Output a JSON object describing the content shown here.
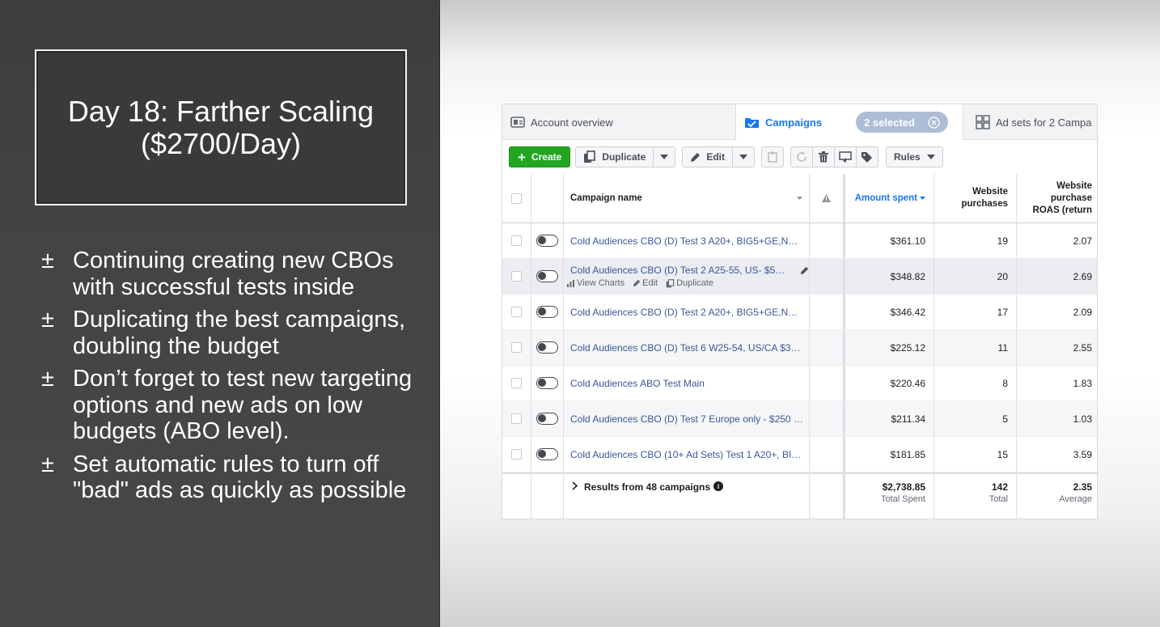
{
  "slide": {
    "title": "Day 18: Farther Scaling\n($2700/Day)",
    "bullet_mark": "±",
    "bullets": [
      "Continuing creating new CBOs with successful tests inside",
      "Duplicating the best campaigns, doubling the budget",
      "Don’t forget to test new targeting options and new ads on low budgets (ABO level).",
      "Set automatic rules to turn off \"bad\" ads as quickly as possible"
    ]
  },
  "ads_manager": {
    "tabs": {
      "account": "Account overview",
      "campaigns": "Campaigns",
      "selected": "2 selected",
      "adsets": "Ad sets for 2 Campa"
    },
    "toolbar": {
      "create": "Create",
      "duplicate": "Duplicate",
      "edit": "Edit",
      "rules": "Rules"
    },
    "columns": {
      "name": "Campaign name",
      "amount": "Amount spent",
      "purchases": "Website purchases",
      "roas": "Website purchase ROAS (return"
    },
    "row_actions": {
      "view_charts": "View Charts",
      "edit": "Edit",
      "duplicate": "Duplicate"
    },
    "rows": [
      {
        "name": "Cold Audiences CBO (D) Test 3 A20+, BIG5+GE,NE-...",
        "amount": "$361.10",
        "purchases": "19",
        "roas": "2.07"
      },
      {
        "name": "Cold Audiences CBO (D) Test 2 A25-55, US- $500...",
        "amount": "$348.82",
        "purchases": "20",
        "roas": "2.69"
      },
      {
        "name": "Cold Audiences CBO (D) Test 2 A20+, BIG5+GE,NE- ...",
        "amount": "$346.42",
        "purchases": "17",
        "roas": "2.09"
      },
      {
        "name": "Cold Audiences CBO (D) Test 6 W25-54, US/CA $30...",
        "amount": "$225.12",
        "purchases": "11",
        "roas": "2.55"
      },
      {
        "name": "Cold Audiences ABO Test Main",
        "amount": "$220.46",
        "purchases": "8",
        "roas": "1.83"
      },
      {
        "name": "Cold Audiences CBO (D) Test 7 Europe only - $250 SB",
        "amount": "$211.34",
        "purchases": "5",
        "roas": "1.03"
      },
      {
        "name": "Cold Audiences CBO (10+ Ad Sets) Test 1 A20+, BIG...",
        "amount": "$181.85",
        "purchases": "15",
        "roas": "3.59"
      }
    ],
    "footer": {
      "results": "Results from 48 campaigns",
      "amount": "$2,738.85",
      "amount_label": "Total Spent",
      "purchases": "142",
      "purchases_label": "Total",
      "roas": "2.35",
      "roas_label": "Average"
    }
  },
  "colors": {
    "slide_bg": "#444444",
    "create_green": "#24a522",
    "link_blue": "#385898",
    "accent_blue": "#1877f2"
  }
}
